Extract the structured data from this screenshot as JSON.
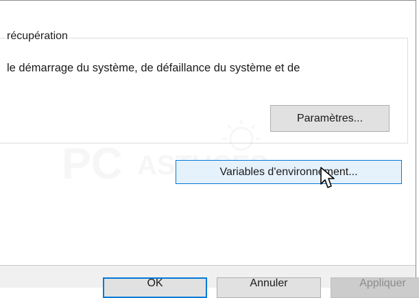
{
  "group": {
    "legend": "récupération",
    "description": "le démarrage du système, de défaillance du système et de",
    "params_label": "Paramètres..."
  },
  "env_button_label": "Variables d'environnement...",
  "footer": {
    "ok_label": "OK",
    "cancel_label": "Annuler",
    "apply_label": "Appliquer"
  },
  "watermark": {
    "text_main": "PC",
    "text_secondary": "ASTUCES",
    "color": "#d9d9d9"
  },
  "colors": {
    "accent": "#0078d7",
    "button_face": "#e1e1e1",
    "hover_face": "#e5f1fb"
  },
  "cursor_icon": "arrow-pointer-icon"
}
